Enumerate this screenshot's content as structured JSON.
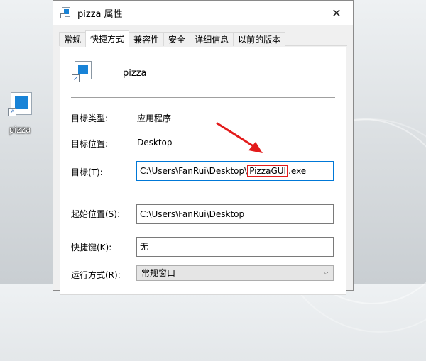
{
  "desktop": {
    "icon_label": "pizza"
  },
  "window": {
    "title": "pizza 属性",
    "close": "✕"
  },
  "tabs": [
    {
      "label": "常规"
    },
    {
      "label": "快捷方式",
      "active": true
    },
    {
      "label": "兼容性"
    },
    {
      "label": "安全"
    },
    {
      "label": "详细信息"
    },
    {
      "label": "以前的版本"
    }
  ],
  "shortcut": {
    "name": "pizza",
    "target_type_label": "目标类型:",
    "target_type_value": "应用程序",
    "target_location_label": "目标位置:",
    "target_location_value": "Desktop",
    "target_label": "目标(T):",
    "target_value_prefix": "C:\\Users\\FanRui\\Desktop\\",
    "target_value_highlight": "PizzaGUI",
    "target_value_suffix": ".exe",
    "start_in_label": "起始位置(S):",
    "start_in_value": "C:\\Users\\FanRui\\Desktop",
    "hotkey_label": "快捷键(K):",
    "hotkey_value": "无",
    "run_label": "运行方式(R):",
    "run_value": "常规窗口"
  },
  "colors": {
    "accent": "#1883d7",
    "annotation": "#e31b1b"
  }
}
